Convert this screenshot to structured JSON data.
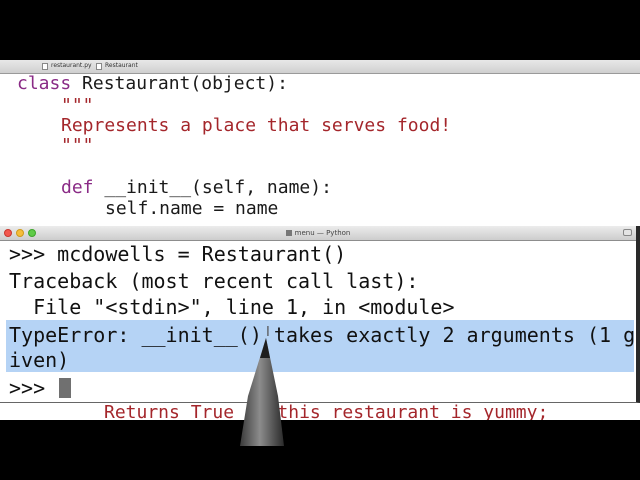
{
  "editor": {
    "tabs": [
      "restaurant.py",
      "Restaurant"
    ],
    "code_lines": [
      {
        "kw": "class",
        "text": " Restaurant(object):"
      },
      {
        "str": "\"\"\""
      },
      {
        "str": "Represents a place that serves food!"
      },
      {
        "str": "\"\"\""
      },
      {
        "kw": "def",
        "text": " __init__(self, name):"
      },
      {
        "text": "self.name = name"
      }
    ],
    "peek_line": "Returns True if this restaurant is yummy;"
  },
  "terminal": {
    "title": "menu — Python",
    "lines": [
      ">>> mcdowells = Restaurant()",
      "Traceback (most recent call last):",
      "  File \"<stdin>\", line 1, in <module>",
      "TypeError: __init__() takes exactly 2 arguments (1 g",
      "iven)",
      ">>> "
    ],
    "highlight_color": "#b5d3f5"
  },
  "colors": {
    "keyword": "#8a2b86",
    "string": "#a4262b",
    "background": "#000000"
  }
}
